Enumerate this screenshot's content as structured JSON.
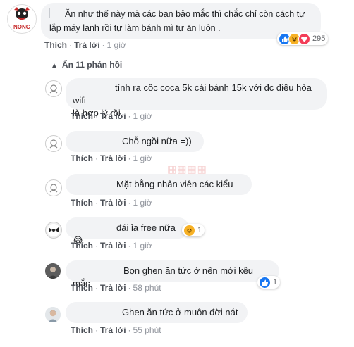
{
  "top_comment": {
    "avatar_logo": "NONG",
    "text": "Ăn như thế này mà các bạn bảo mắc thì chắc chỉ còn cách tự lắp máy lạnh rồi tự làm bánh mì tự ăn luôn .",
    "reaction_count": "295",
    "reactions": [
      "like-icon",
      "haha-icon",
      "love-icon"
    ],
    "actions": {
      "like": "Thích",
      "reply": "Trả lời",
      "time": "1 giờ"
    }
  },
  "replies_toggle": "Ẩn 11 phản hồi",
  "replies": [
    {
      "text_line1": "tính ra cốc coca 5k cái bánh 15k với đc điều hòa wifi",
      "text_line2": "là hợp lý rồi",
      "actions": {
        "like": "Thích",
        "reply": "Trả lời",
        "time": "1 giờ"
      }
    },
    {
      "text": "Chỗ ngồi nữa =))",
      "actions": {
        "like": "Thích",
        "reply": "Trả lời",
        "time": "1 giờ"
      }
    },
    {
      "text": "Mặt bằng nhân viên các kiểu",
      "actions": {
        "like": "Thích",
        "reply": "Trả lời",
        "time": "1 giờ"
      }
    },
    {
      "text": "đái ỉa free nữa 😂",
      "reaction_count": "1",
      "actions": {
        "like": "Thích",
        "reply": "Trả lời",
        "time": "1 giờ"
      }
    },
    {
      "text": "Bọn ghen ăn tức ở nên mới kêu mắc",
      "reaction_count": "1",
      "actions": {
        "like": "Thích",
        "reply": "Trả lời",
        "time": "58 phút"
      }
    },
    {
      "text": "Ghen ăn tức ở muôn đời nát",
      "actions": {
        "like": "Thích",
        "reply": "Trả lời",
        "time": "55 phút"
      }
    }
  ],
  "colors": {
    "bubble": "#f2f3f5",
    "link": "#4b4f56",
    "meta": "#90949c",
    "like": "#1877f2",
    "haha": "#f7b125",
    "love": "#f33e58"
  }
}
